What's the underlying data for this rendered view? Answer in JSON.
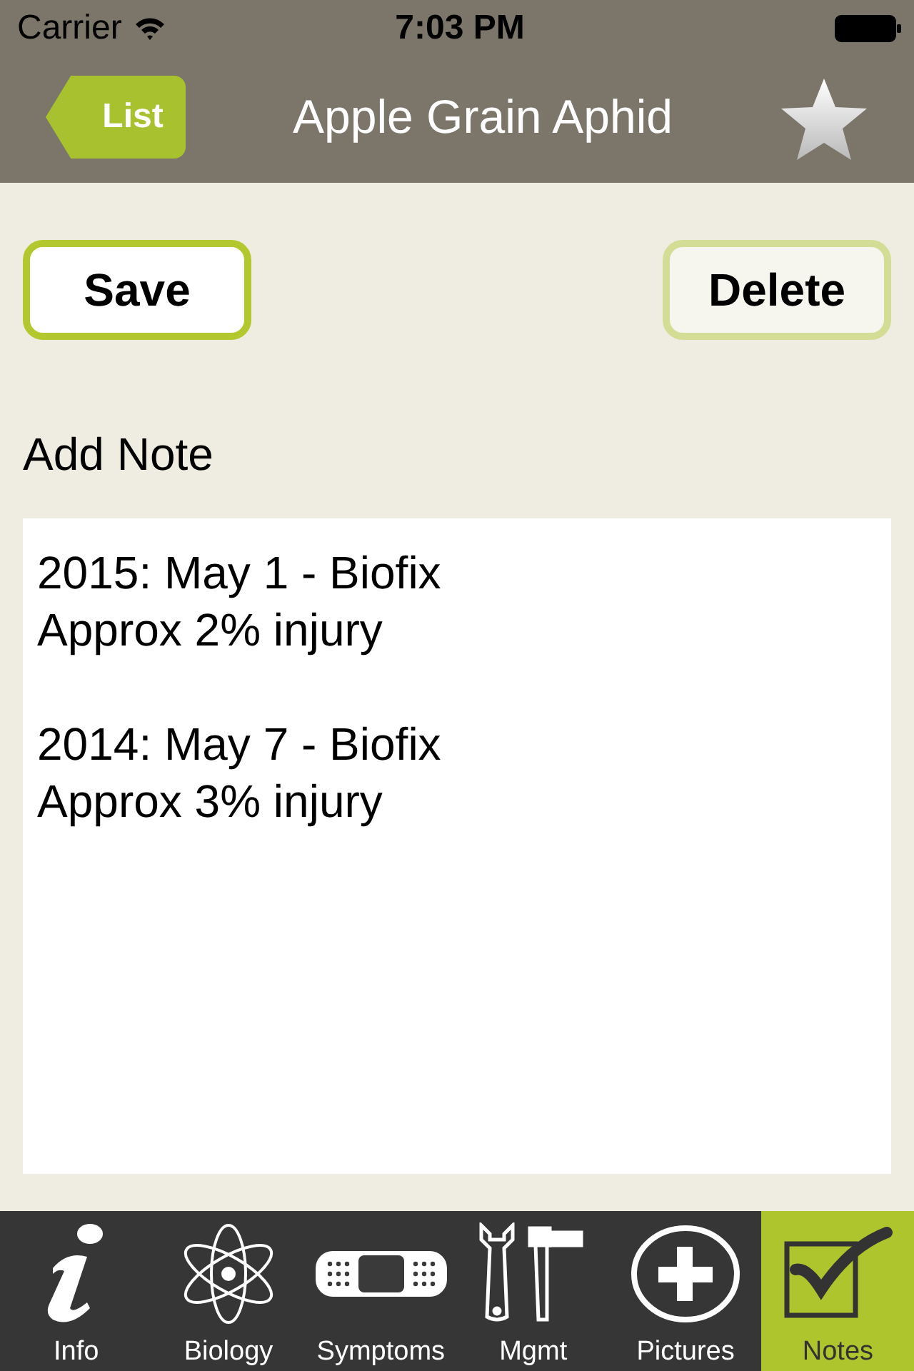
{
  "status_bar": {
    "carrier": "Carrier",
    "time": "7:03 PM"
  },
  "nav_bar": {
    "back": "List",
    "title": "Apple Grain Aphid",
    "favorite": false
  },
  "buttons": [
    {
      "label": "Save",
      "disabled": false
    },
    {
      "label": "Delete",
      "disabled": true
    }
  ],
  "note_label": "Add Note",
  "note": {
    "value": "2015: May 1 - Biofix\nApprox 2% injury\n\n2014: May 7 - Biofix\nApprox 3% injury"
  },
  "tabs": [
    {
      "label": "Info",
      "kind": "info",
      "selected": false
    },
    {
      "label": "Biology",
      "kind": "atom",
      "selected": false
    },
    {
      "label": "Symptoms",
      "kind": "bandage",
      "selected": false
    },
    {
      "label": "Mgmt",
      "kind": "tools",
      "selected": false
    },
    {
      "label": "Pictures",
      "kind": "plus",
      "selected": false
    },
    {
      "label": "Notes",
      "kind": "check",
      "selected": true
    }
  ]
}
